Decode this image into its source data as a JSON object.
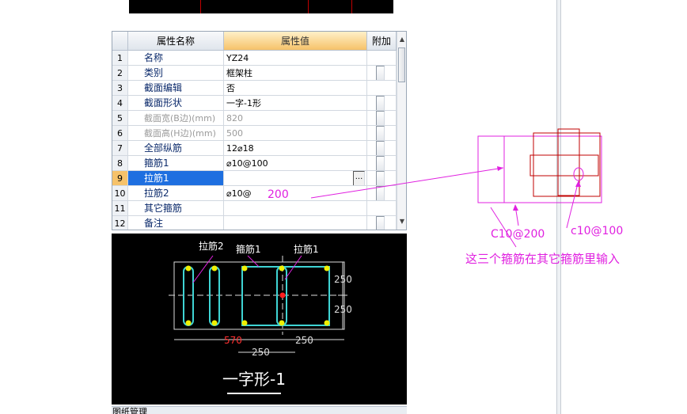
{
  "header": {
    "col_name": "属性名称",
    "col_value": "属性值",
    "col_extra": "附加"
  },
  "rows": [
    {
      "no": "1",
      "name": "名称",
      "value": "YZ24",
      "checkbox": false,
      "disabled": false
    },
    {
      "no": "2",
      "name": "类别",
      "value": "框架柱",
      "checkbox": true,
      "disabled": false
    },
    {
      "no": "3",
      "name": "截面编辑",
      "value": "否",
      "checkbox": false,
      "disabled": false
    },
    {
      "no": "4",
      "name": "截面形状",
      "value": "一字-1形",
      "checkbox": true,
      "disabled": false
    },
    {
      "no": "5",
      "name": "截面宽(B边)(mm)",
      "value": "820",
      "checkbox": true,
      "disabled": true
    },
    {
      "no": "6",
      "name": "截面高(H边)(mm)",
      "value": "500",
      "checkbox": true,
      "disabled": true
    },
    {
      "no": "7",
      "name": "全部纵筋",
      "value": "12⌀18",
      "checkbox": true,
      "disabled": false
    },
    {
      "no": "8",
      "name": "箍筋1",
      "value": "⌀10@100",
      "checkbox": true,
      "disabled": false
    },
    {
      "no": "9",
      "name": "拉筋1",
      "value": "",
      "checkbox": true,
      "disabled": false,
      "selected": true,
      "ellipsis": "···"
    },
    {
      "no": "10",
      "name": "拉筋2",
      "value": "⌀10@",
      "checkbox": true,
      "disabled": false
    },
    {
      "no": "11",
      "name": "其它箍筋",
      "value": "",
      "checkbox": false,
      "disabled": false
    },
    {
      "no": "12",
      "name": "备注",
      "value": "",
      "checkbox": true,
      "disabled": false
    }
  ],
  "preview": {
    "label_tie2": "拉筋2",
    "label_stirrup1": "箍筋1",
    "label_tie1": "拉筋1",
    "dim_250_top": "250",
    "dim_250_bottom": "250",
    "dim_570": "570",
    "dim_250_mid": "250",
    "dim_250_right": "250",
    "shape_name": "一字形-1"
  },
  "bottom_bar": {
    "label": "图纸管理"
  },
  "annotations": {
    "text_200": "200",
    "text_c10_200": "C10@200",
    "text_c10_100": "c10@100",
    "text_note": "这三个箍筋在其它箍筋里输入",
    "color": "#e020e0"
  }
}
